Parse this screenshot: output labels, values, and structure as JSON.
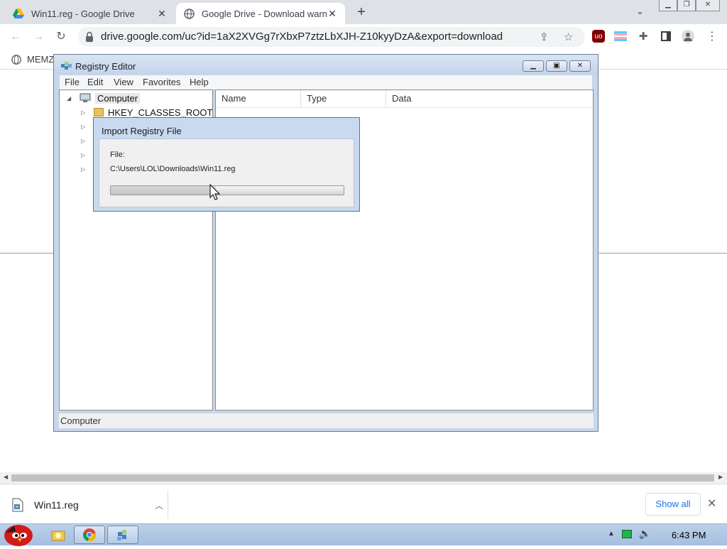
{
  "browser": {
    "tabs": [
      {
        "title": "Win11.reg - Google Drive",
        "favicon": "google-drive-icon",
        "active": false
      },
      {
        "title": "Google Drive - Download warning",
        "favicon": "globe-icon",
        "active": true
      }
    ],
    "new_tab_symbol": "+",
    "url": "drive.google.com/uc?id=1aX2XVGg7rXbxP7ztzLbXJH-Z10kyyDzA&export=download",
    "bookmarks": [
      {
        "label": "MEMZ"
      }
    ]
  },
  "regedit": {
    "title": "Registry Editor",
    "menu": [
      "File",
      "Edit",
      "View",
      "Favorites",
      "Help"
    ],
    "tree": {
      "root": "Computer",
      "children": [
        "HKEY_CLASSES_ROOT",
        "",
        "",
        "",
        ""
      ]
    },
    "columns": [
      "Name",
      "Type",
      "Data"
    ],
    "status": "Computer"
  },
  "import_dialog": {
    "title": "Import Registry File",
    "file_label": "File:",
    "file_path": "C:\\Users\\LOL\\Downloads\\Win11.reg",
    "progress": 0.45
  },
  "download_bar": {
    "file_name": "Win11.reg",
    "show_all": "Show all"
  },
  "taskbar": {
    "clock": "6:43 PM",
    "pinned": [
      "file-explorer-icon",
      "chrome-icon",
      "regedit-icon"
    ]
  },
  "colors": {
    "chrome_tabstrip": "#dee1e6",
    "link_blue": "#1a73e8",
    "taskbar": "#a6bfdf",
    "window_frame": "#c6d7ec"
  }
}
